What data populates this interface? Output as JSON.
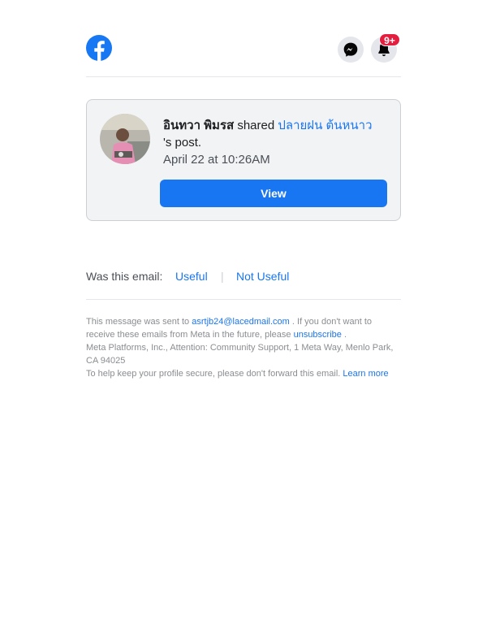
{
  "header": {
    "notification_count": "9+"
  },
  "story": {
    "actor_name": "อินทวา พิมรส",
    "verb": "shared",
    "owner_name": "ปลายฝน ต้นหนาว",
    "suffix": "'s post.",
    "timestamp": "April 22 at 10:26AM",
    "view_label": "View"
  },
  "feedback": {
    "question": "Was this email:",
    "useful": "Useful",
    "separator": "|",
    "not_useful": "Not Useful"
  },
  "footer": {
    "sent_prefix": "This message was sent to",
    "email": "asrtjb24@lacedmail.com",
    "sent_suffix": ". If you don't want to receive these emails from Meta in the future, please",
    "unsubscribe": "unsubscribe",
    "period": ".",
    "address": "Meta Platforms, Inc., Attention: Community Support, 1 Meta Way, Menlo Park, CA 94025",
    "secure_text": "To help keep your profile secure, please don't forward this email.",
    "learn_more": "Learn more"
  },
  "colors": {
    "brand": "#1877f2",
    "badge": "#e41e3f",
    "link": "#1876f2"
  },
  "icons": {
    "logo": "facebook-logo",
    "messenger": "messenger-icon",
    "notifications": "bell-icon"
  }
}
